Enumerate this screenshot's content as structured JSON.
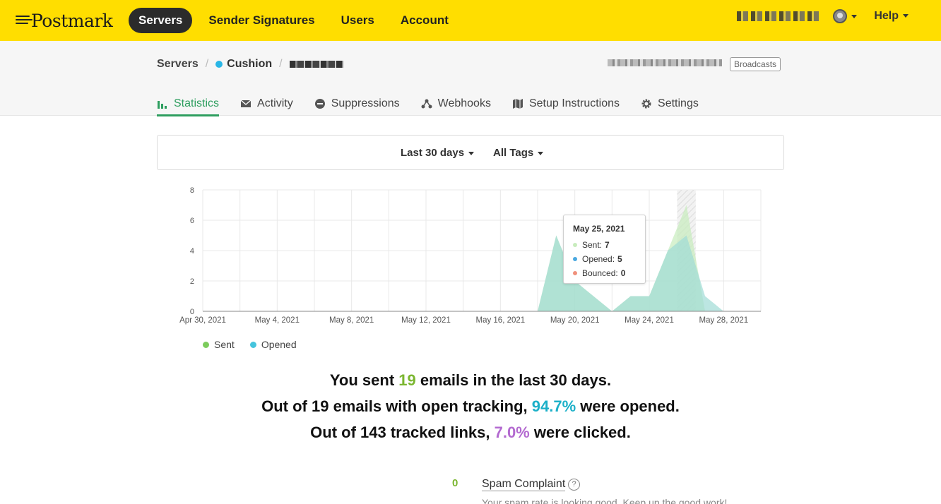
{
  "topbar": {
    "logo": "Postmark",
    "nav": [
      {
        "label": "Servers",
        "active": true
      },
      {
        "label": "Sender Signatures",
        "active": false
      },
      {
        "label": "Users",
        "active": false
      },
      {
        "label": "Account",
        "active": false
      }
    ],
    "help": "Help",
    "bg_color": "#ffde00"
  },
  "breadcrumb": {
    "root": "Servers",
    "server": "Cushion",
    "server_dot_color": "#29b6e6",
    "badge": "Broadcasts"
  },
  "tabs": [
    {
      "label": "Statistics",
      "icon": "bar-chart-icon",
      "active": true
    },
    {
      "label": "Activity",
      "icon": "envelope-icon",
      "active": false
    },
    {
      "label": "Suppressions",
      "icon": "minus-circle-icon",
      "active": false
    },
    {
      "label": "Webhooks",
      "icon": "webhook-icon",
      "active": false
    },
    {
      "label": "Setup Instructions",
      "icon": "map-icon",
      "active": false
    },
    {
      "label": "Settings",
      "icon": "gear-icon",
      "active": false
    }
  ],
  "filters": {
    "range": "Last 30 days",
    "tags": "All Tags"
  },
  "chart_data": {
    "type": "area",
    "x_tick_labels": [
      "Apr 30, 2021",
      "May 4, 2021",
      "May 8, 2021",
      "May 12, 2021",
      "May 16, 2021",
      "May 20, 2021",
      "May 24, 2021",
      "May 28, 2021"
    ],
    "y_tick_labels": [
      "0",
      "2",
      "4",
      "6",
      "8"
    ],
    "ylim": [
      0,
      8
    ],
    "x_start": "2021-04-30",
    "grid": true,
    "legend_position": "bottom-left",
    "series": [
      {
        "name": "Sent",
        "color": "#7ccc5c",
        "values": [
          0,
          0,
          0,
          0,
          0,
          0,
          0,
          0,
          0,
          0,
          0,
          0,
          0,
          0,
          0,
          0,
          0,
          0,
          0,
          5,
          2,
          1,
          0,
          1,
          1,
          4,
          7,
          0,
          0,
          0,
          0
        ]
      },
      {
        "name": "Opened",
        "color": "#45c4dd",
        "values": [
          0,
          0,
          0,
          0,
          0,
          0,
          0,
          0,
          0,
          0,
          0,
          0,
          0,
          0,
          0,
          0,
          0,
          0,
          0,
          5,
          2,
          1,
          0,
          1,
          1,
          4,
          5,
          1,
          0,
          0,
          0
        ]
      }
    ],
    "highlight_index": 25,
    "tooltip": {
      "title": "May 25, 2021",
      "rows": [
        {
          "label": "Sent:",
          "value": "7",
          "color": "#c8ecbd"
        },
        {
          "label": "Opened:",
          "value": "5",
          "color": "#4aa8e0"
        },
        {
          "label": "Bounced:",
          "value": "0",
          "color": "#f0917c"
        }
      ]
    }
  },
  "legend": [
    {
      "label": "Sent",
      "color": "#7ccc5c"
    },
    {
      "label": "Opened",
      "color": "#45c4dd"
    }
  ],
  "summary": {
    "line1_pre": "You sent ",
    "line1_num": "19",
    "line1_post": " emails in the last 30 days.",
    "line2_pre": "Out of 19 emails with open tracking, ",
    "line2_num": "94.7%",
    "line2_post": " were opened.",
    "line3_pre": "Out of 143 tracked links, ",
    "line3_num": "7.0%",
    "line3_post": " were clicked."
  },
  "spam": {
    "count": "0",
    "label": "Spam Complaint",
    "help": "?",
    "desc": "Your spam rate is looking good. Keep up the good work!"
  }
}
